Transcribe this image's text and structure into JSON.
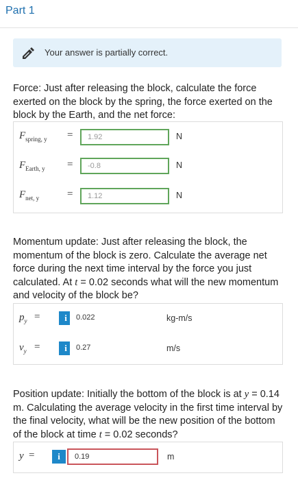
{
  "part": {
    "title": "Part 1"
  },
  "alert": {
    "text": "Your answer is partially correct.",
    "icon": "pencil-icon",
    "bg_color": "#e4f1fa"
  },
  "force": {
    "question": "Force: Just after releasing the block, calculate the force exerted on the block by the spring, the force exerted on the block by the Earth, and the net force:",
    "rows": [
      {
        "symbol": "F",
        "subscript": "spring, y",
        "value": "1.92",
        "unit": "N",
        "status": "correct"
      },
      {
        "symbol": "F",
        "subscript": "Earth, y",
        "value": "-0.8",
        "unit": "N",
        "status": "correct"
      },
      {
        "symbol": "F",
        "subscript": "net, y",
        "value": "1.12",
        "unit": "N",
        "status": "correct"
      }
    ]
  },
  "momentum": {
    "question_line1": "Momentum update: Just after releasing the block, the momentum of the block is zero. Calculate the average net force during the next time interval by the force you just calculated. At ",
    "question_var": "t",
    "question_line2": " = 0.02 seconds what will the new momentum and velocity of the block be?",
    "rows": [
      {
        "symbol": "p",
        "subscript": "y",
        "value": "0.022",
        "unit": "kg-m/s"
      },
      {
        "symbol": "v",
        "subscript": "y",
        "value": "0.27",
        "unit": "m/s"
      }
    ]
  },
  "position": {
    "question_part1": "Position update: Initially the bottom of the block is at ",
    "question_var1": "y",
    "question_part2": " = 0.14 m. Calculating the average velocity in the first time interval by the final velocity, what will be the new position of the bottom of the block at time ",
    "question_var2": "t",
    "question_part3": " = 0.02 seconds?",
    "row": {
      "symbol": "y",
      "value": "0.19",
      "unit": "m",
      "status": "incorrect"
    }
  },
  "colors": {
    "accent": "#1e6fae",
    "correct": "#5fa55a",
    "incorrect": "#c9545a",
    "info": "#1e88c9"
  }
}
